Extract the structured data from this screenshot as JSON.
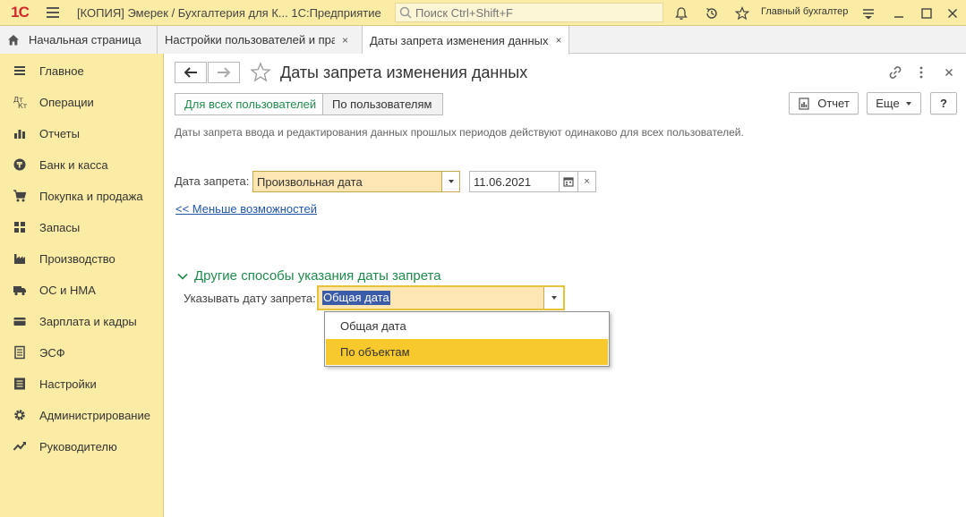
{
  "app": {
    "logo_text": "1С",
    "title": "[КОПИЯ] Эмерек / Бухгалтерия для К...  1С:Предприятие",
    "search_placeholder": "Поиск Ctrl+Shift+F",
    "user": "Главный бухгалтер"
  },
  "tabs": [
    {
      "label": "Начальная страница"
    },
    {
      "label": "Настройки пользователей и прав"
    },
    {
      "label": "Даты запрета изменения данных"
    }
  ],
  "tab_close": "×",
  "sidebar": {
    "items": [
      {
        "label": "Главное",
        "icon": "menu-lines-icon"
      },
      {
        "label": "Операции",
        "icon": "operations-icon"
      },
      {
        "label": "Отчеты",
        "icon": "bar-chart-icon"
      },
      {
        "label": "Банк и касса",
        "icon": "coin-icon"
      },
      {
        "label": "Покупка и продажа",
        "icon": "cart-icon"
      },
      {
        "label": "Запасы",
        "icon": "warehouse-grid-icon"
      },
      {
        "label": "Производство",
        "icon": "factory-icon"
      },
      {
        "label": "ОС и НМА",
        "icon": "truck-icon"
      },
      {
        "label": "Зарплата и кадры",
        "icon": "wallet-icon"
      },
      {
        "label": "ЭСФ",
        "icon": "document-icon"
      },
      {
        "label": "Настройки",
        "icon": "settings-list-icon"
      },
      {
        "label": "Администрирование",
        "icon": "gear-icon"
      },
      {
        "label": "Руководителю",
        "icon": "trend-icon"
      }
    ]
  },
  "form": {
    "title": "Даты запрета изменения данных",
    "segments": {
      "all_users": "Для всех пользователей",
      "by_users": "По пользователям"
    },
    "report_button": "Отчет",
    "more_button": "Еще",
    "help_button": "?",
    "info_text": "Даты запрета ввода и редактирования данных прошлых периодов действуют одинаково для всех пользователей.",
    "date_label": "Дата запрета:",
    "date_mode": "Произвольная дата",
    "date_value": "11.06.2021",
    "clear_glyph": "×",
    "less_link": "<< Меньше возможностей",
    "group_title": "Другие способы указания даты запрета",
    "method_label": "Указывать дату запрета:",
    "method_value": "Общая дата",
    "dropdown_options": [
      "Общая дата",
      "По объектам"
    ],
    "dropdown_selected_index": 1
  },
  "colors": {
    "topbar_bg": "#fbeca5",
    "sidebar_bg": "#fbeca5",
    "accent_green": "#1f8a4c",
    "link_blue": "#2255aa",
    "selected_item": "#f8c92c",
    "logo_red": "#d3282c"
  }
}
